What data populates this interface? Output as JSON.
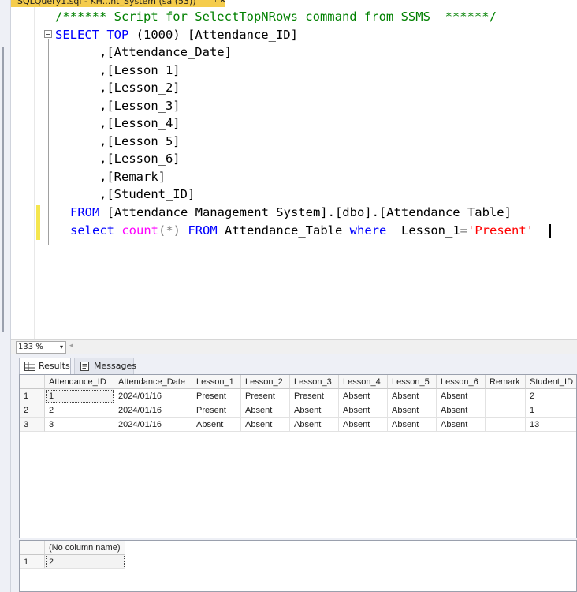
{
  "document_tab": {
    "title": "SQLQuery1.sql - KH...nt_System (sa (53))",
    "pin_glyph": "⊣",
    "close_glyph": "✕"
  },
  "editor": {
    "lines": {
      "l1": "/****** Script for SelectTopNRows command from SSMS  ******/",
      "l2_kw": "SELECT TOP",
      "l2_rest": " (1000) [Attendance_ID]",
      "l3": "      ,[Attendance_Date]",
      "l4": "      ,[Lesson_1]",
      "l5": "      ,[Lesson_2]",
      "l6": "      ,[Lesson_3]",
      "l7": "      ,[Lesson_4]",
      "l8": "      ,[Lesson_5]",
      "l9": "      ,[Lesson_6]",
      "l10": "      ,[Remark]",
      "l11": "      ,[Student_ID]",
      "l12_kw": "FROM",
      "l12_rest": " [Attendance_Management_System].[dbo].[Attendance_Table]",
      "l13_select": "select",
      "l13_count": "count",
      "l13_star": "(*)",
      "l13_from": "FROM",
      "l13_table": " Attendance_Table ",
      "l13_where": "where",
      "l13_col": "  Lesson_1",
      "l13_eq": "=",
      "l13_str": "'Present'"
    }
  },
  "zoom": {
    "value": "133 %",
    "dropdown_glyph": "▾",
    "scroll_glyph": "◂"
  },
  "tabs": {
    "results": "Results",
    "messages": "Messages"
  },
  "grid1": {
    "headers": [
      "Attendance_ID",
      "Attendance_Date",
      "Lesson_1",
      "Lesson_2",
      "Lesson_3",
      "Lesson_4",
      "Lesson_5",
      "Lesson_6",
      "Remark",
      "Student_ID"
    ],
    "rows": [
      [
        "1",
        "1",
        "2024/01/16",
        "Present",
        "Present",
        "Present",
        "Absent",
        "Absent",
        "Absent",
        "",
        "2"
      ],
      [
        "2",
        "2",
        "2024/01/16",
        "Present",
        "Absent",
        "Absent",
        "Absent",
        "Absent",
        "Absent",
        "",
        "1"
      ],
      [
        "3",
        "3",
        "2024/01/16",
        "Absent",
        "Absent",
        "Absent",
        "Absent",
        "Absent",
        "Absent",
        "",
        "13"
      ]
    ]
  },
  "grid2": {
    "header": "(No column name)",
    "rows": [
      [
        "1",
        "2"
      ]
    ]
  },
  "colors": {
    "tab_active": "#f5cc4c",
    "keyword": "#0000ff",
    "function": "#ff00ff",
    "string": "#ff0000",
    "comment": "#008000"
  }
}
